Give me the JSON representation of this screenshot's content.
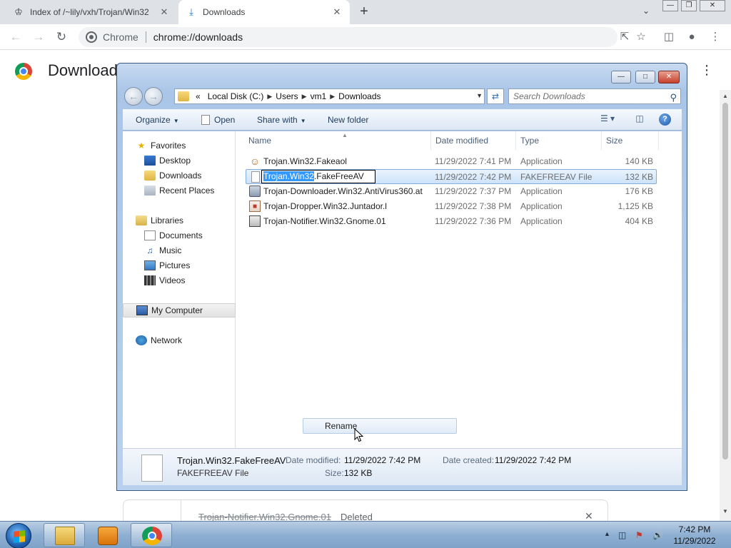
{
  "browser": {
    "tabs": [
      {
        "title": "Index of /~lily/vxh/Trojan/Win32",
        "active": false,
        "icon": "web-page-icon"
      },
      {
        "title": "Downloads",
        "active": true,
        "icon": "download-icon"
      }
    ],
    "omnibox": {
      "chip": "Chrome",
      "url": "chrome://downloads"
    }
  },
  "downloads_page": {
    "title": "Downloads",
    "item": {
      "filename": "Trojan-Notifier.Win32.Gnome.01",
      "status": "Deleted"
    }
  },
  "explorer": {
    "breadcrumb": [
      "Local Disk (C:)",
      "Users",
      "vm1",
      "Downloads"
    ],
    "search_placeholder": "Search Downloads",
    "commands": {
      "organize": "Organize",
      "open": "Open",
      "share_with": "Share with",
      "new_folder": "New folder"
    },
    "nav_pane": {
      "favorites": "Favorites",
      "favorites_items": [
        "Desktop",
        "Downloads",
        "Recent Places"
      ],
      "libraries": "Libraries",
      "libraries_items": [
        "Documents",
        "Music",
        "Pictures",
        "Videos"
      ],
      "my_computer": "My Computer",
      "network": "Network"
    },
    "columns": {
      "name": "Name",
      "date": "Date modified",
      "type": "Type",
      "size": "Size"
    },
    "files": [
      {
        "name": "Trojan.Win32.Fakeaol",
        "date": "11/29/2022 7:41 PM",
        "type": "Application",
        "size": "140 KB",
        "icon": "application-icon"
      },
      {
        "name": "Trojan.Win32.FakeFreeAV",
        "date": "11/29/2022 7:42 PM",
        "type": "FAKEFREEAV File",
        "size": "132 KB",
        "icon": "blank-file-icon",
        "selected": true
      },
      {
        "name": "Trojan-Downloader.Win32.AntiVirus360.at",
        "date": "11/29/2022 7:37 PM",
        "type": "Application",
        "size": "176 KB",
        "icon": "application-icon"
      },
      {
        "name": "Trojan-Dropper.Win32.Juntador.l",
        "date": "11/29/2022 7:38 PM",
        "type": "Application",
        "size": "1,125 KB",
        "icon": "application-icon"
      },
      {
        "name": "Trojan-Notifier.Win32.Gnome.01",
        "date": "11/29/2022 7:36 PM",
        "type": "Application",
        "size": "404 KB",
        "icon": "application-icon"
      }
    ],
    "rename_edit": {
      "selected_part": "Trojan.Win32",
      "rest": ".FakeFreeAV"
    },
    "context_menu": {
      "rename": "Rename"
    },
    "details": {
      "name": "Trojan.Win32.FakeFreeAV",
      "type": "FAKEFREEAV File",
      "date_modified_label": "Date modified:",
      "date_modified": "11/29/2022 7:42 PM",
      "size_label": "Size:",
      "size": "132 KB",
      "date_created_label": "Date created:",
      "date_created": "11/29/2022 7:42 PM"
    }
  },
  "taskbar": {
    "time": "7:42 PM",
    "date": "11/29/2022"
  },
  "colors": {
    "selection": "#cde3fa",
    "rename_highlight": "#3399ff",
    "taskbar": "#8fb0d2"
  }
}
